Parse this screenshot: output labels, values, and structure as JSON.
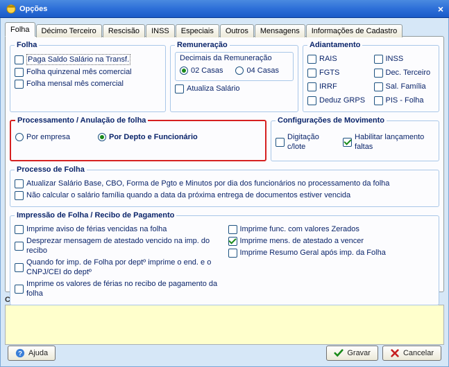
{
  "window": {
    "title": "Opções"
  },
  "tabs": [
    "Folha",
    "Décimo Terceiro",
    "Rescisão",
    "INSS",
    "Especiais",
    "Outros",
    "Mensagens",
    "Informações de Cadastro"
  ],
  "folha": {
    "legend": "Folha",
    "chk1": "Paga Saldo Salário na Transf.",
    "chk2": "Folha quinzenal mês comercial",
    "chk3": "Folha mensal mês comercial"
  },
  "remuneracao": {
    "legend": "Remuneração",
    "decimais_label": "Decimais da Remuneração",
    "opt2": "02 Casas",
    "opt4": "04 Casas",
    "atualiza": "Atualiza Salário"
  },
  "adiantamento": {
    "legend": "Adiantamento",
    "rais": "RAIS",
    "inss": "INSS",
    "fgts": "FGTS",
    "dec": "Dec. Terceiro",
    "irrf": "IRRF",
    "sal": "Sal. Família",
    "deduz": "Deduz GRPS",
    "pis": "PIS - Folha"
  },
  "proc_anul": {
    "legend": "Processamento / Anulação de folha",
    "por_empresa": "Por empresa",
    "por_depto": "Por Depto e Funcionário"
  },
  "config_mov": {
    "legend": "Configurações de Movimento",
    "dig": "Digitação c/lote",
    "hab": "Habilitar lançamento faltas"
  },
  "processo": {
    "legend": "Processo de Folha",
    "l1": "Atualizar Salário Base, CBO, Forma de Pgto e Minutos por dia dos funcionários no processamento da folha",
    "l2": "Não calcular o salário família quando a data da próxima entrega de documentos estiver vencida"
  },
  "impressao": {
    "legend": "Impressão de Folha / Recibo de Pagamento",
    "a": "Imprime aviso de férias vencidas na folha",
    "b": "Desprezar mensagem de atestado vencido na imp. do recibo",
    "c": "Quando for imp. de Folha por deptº imprime o end. e o CNPJ/CEI do deptº",
    "d": "Imprime os valores de férias no recibo de pagamento da folha",
    "e": "Imprime func. com valores Zerados",
    "f": "Imprime mens. de  atestado a vencer",
    "g": "Imprime Resumo Geral após imp. da Folha"
  },
  "comment": {
    "label": "Comentário"
  },
  "buttons": {
    "ajuda": "Ajuda",
    "gravar": "Gravar",
    "cancelar": "Cancelar"
  }
}
